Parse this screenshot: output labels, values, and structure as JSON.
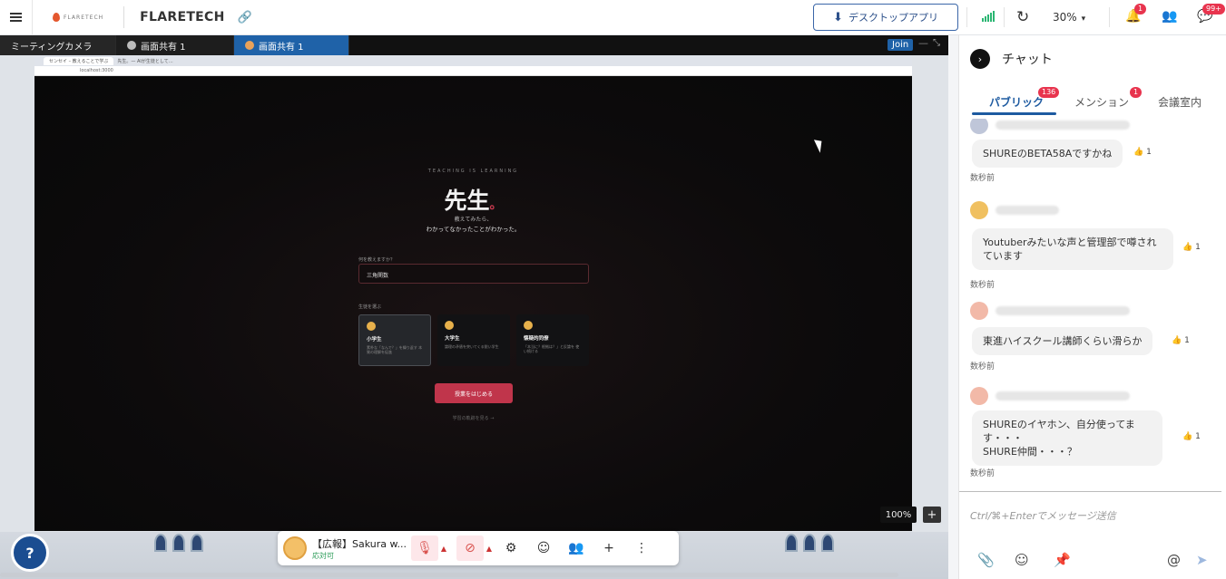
{
  "topbar": {
    "brand": "FLARETECH",
    "title": "FLARETECH",
    "desktop_app": "デスクトップアプリ",
    "zoom": "30%",
    "bell_badge": "1",
    "chat_badge": "99+",
    "accent": "#2b6cd4"
  },
  "stage": {
    "tabs": [
      "ミーティングカメラ",
      "画面共有 1",
      "画面共有 1"
    ],
    "join": "Join",
    "zoom_level": "100%",
    "plus": "+"
  },
  "shared": {
    "browser_tab1": "センセイ – 教えることで学ぶ",
    "browser_tab2": "先生。— AIが生徒として…",
    "url": "localhost:3000",
    "tag": "TEACHING IS LEARNING",
    "hero": "先生",
    "hero_mark": "。",
    "sub1": "教えてみたら、",
    "sub2": "わかってなかったことがわかった。",
    "question_label": "何を教えますか？",
    "question_value": "三角関数",
    "choose_label": "生徒を選ぶ",
    "cards": [
      {
        "title": "小学生",
        "desc": "素朴な「なんで？」を繰り返す 本質の理解を促進"
      },
      {
        "title": "大学生",
        "desc": "論理の矛盾を突いてくる鋭い学生"
      },
      {
        "title": "懐疑的同僚",
        "desc": "「本当に？根拠は？」と反論を 使い続ける"
      }
    ],
    "start": "授業をはじめる",
    "history": "学習の軌跡を見る →"
  },
  "toolbar": {
    "user_name": "【広報】Sakura w...",
    "status": "応対可"
  },
  "chat": {
    "title": "チャット",
    "tabs": [
      {
        "label": "パブリック",
        "badge": "136"
      },
      {
        "label": "メンション",
        "badge": "1"
      },
      {
        "label": "会議室内",
        "badge": ""
      }
    ],
    "messages": [
      {
        "text": "SHUREのBETA58Aですかね",
        "reaction": "👍 1",
        "time": "数秒前"
      },
      {
        "text": "Youtuberみたいな声と管理部で噂されています",
        "reaction": "👍 1",
        "time": "数秒前"
      },
      {
        "text": "東進ハイスクール講師くらい滑らか",
        "reaction": "👍 1",
        "time": "数秒前"
      },
      {
        "text": "SHUREのイヤホン、自分使ってます・・・\nSHURE仲間・・・？",
        "reaction": "👍 1",
        "time": "数秒前"
      }
    ],
    "input_placeholder": "Ctrl/⌘+Enterでメッセージ送信"
  }
}
